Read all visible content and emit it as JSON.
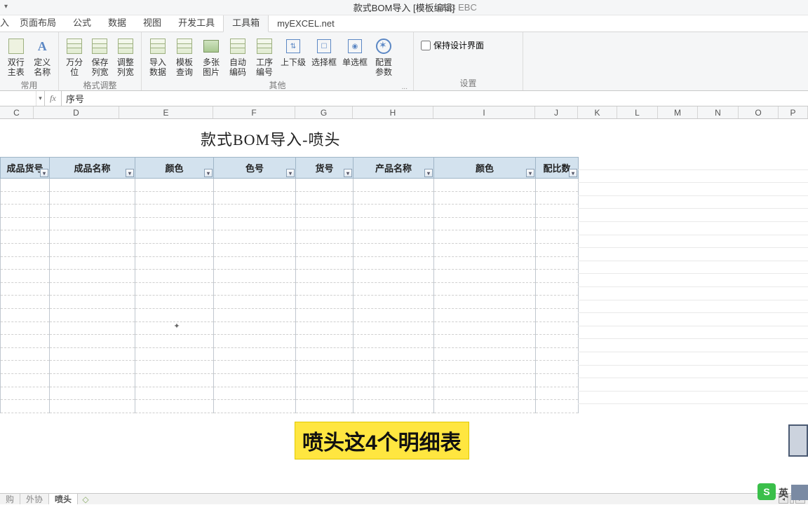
{
  "titlebar": {
    "center": "款式BOM导入 [模板编辑]",
    "right": "E/3 EBC"
  },
  "tabs": {
    "t0": "入",
    "t1": "页面布局",
    "t2": "公式",
    "t3": "数据",
    "t4": "视图",
    "t5": "开发工具",
    "t6": "工具箱",
    "t7": "myEXCEL.net"
  },
  "ribbon": {
    "g1": {
      "btn1": "双行\n主表",
      "btn2": "定义\n名称",
      "label": "常用"
    },
    "g2": {
      "btn1": "万分位",
      "btn2": "保存\n列宽",
      "btn3": "调整\n列宽",
      "label": "格式调整"
    },
    "g3": {
      "btn1": "导入\n数据",
      "btn2": "模板\n查询",
      "btn3": "多张\n图片",
      "btn4": "自动\n编码",
      "btn5": "工序\n编号",
      "btn6": "上下级",
      "btn7": "选择框",
      "btn8": "单选框",
      "btn9": "配置\n参数",
      "label": "其他",
      "ellipsis": "..."
    },
    "g4": {
      "check": "保持设计界面",
      "label": "设置"
    }
  },
  "formula": {
    "fx": "fx",
    "value": "序号"
  },
  "columns": {
    "C": "C",
    "D": "D",
    "E": "E",
    "F": "F",
    "G": "G",
    "H": "H",
    "I": "I",
    "J": "J",
    "K": "K",
    "L": "L",
    "M": "M",
    "N": "N",
    "O": "O",
    "P": "P"
  },
  "sheetTitle": "款式BOM导入-喷头",
  "headers": {
    "h1": "成品货号",
    "h2": "成品名称",
    "h3": "颜色",
    "h4": "色号",
    "h5": "货号",
    "h6": "产品名称",
    "h7": "颜色",
    "h8": "配比数"
  },
  "caption": "喷头这4个明细表",
  "sheetTabs": {
    "t1": "购",
    "t2": "外协",
    "t3": "喷头"
  },
  "ime": {
    "icon": "S",
    "lang": "英"
  }
}
